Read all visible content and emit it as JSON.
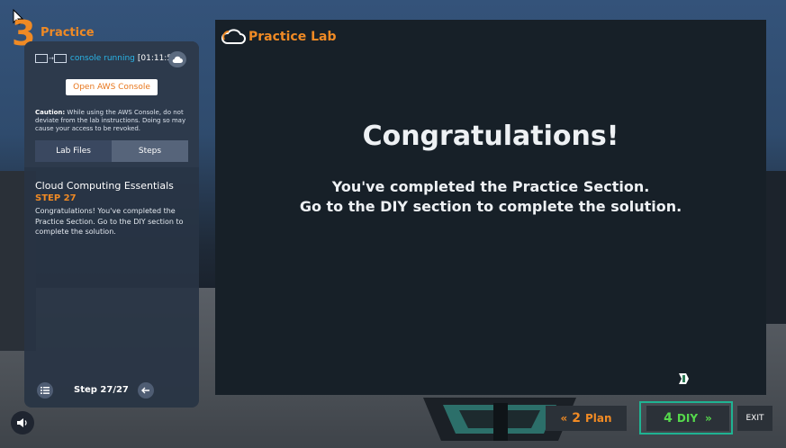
{
  "phase": {
    "number": "3",
    "title": "Practice"
  },
  "left_panel": {
    "console_state": "console running",
    "timer": "[01:11:55]",
    "open_console_label": "Open AWS Console",
    "caution_label": "Caution:",
    "caution_text": " While using the AWS Console, do not deviate from the lab instructions. Doing so may cause your access to be revoked.",
    "tabs": [
      {
        "label": "Lab Files"
      },
      {
        "label": "Steps"
      }
    ],
    "course_title": "Cloud Computing Essentials",
    "step_label": "STEP 27",
    "step_text": "Congratulations! You've completed the Practice Section. Go to the DIY section to complete the solution.",
    "step_counter": "Step 27/27"
  },
  "main": {
    "logo_title": "Practice Lab",
    "heading": "Congratulations!",
    "line1": "You've completed the Practice Section.",
    "line2": "Go to the DIY section to complete the solution."
  },
  "nav": {
    "plan": {
      "number": "2",
      "label": "Plan"
    },
    "diy": {
      "number": "4",
      "label": "DIY"
    },
    "exit": "EXIT"
  },
  "colors": {
    "accent_orange": "#f08a24",
    "accent_green": "#55d84c",
    "frame_teal": "#1fb392",
    "status_blue": "#2ab4e6"
  },
  "icons": [
    "cursor-icon",
    "cloud-icon",
    "list-icon",
    "back-arrow-icon",
    "speaker-icon",
    "chevron-left-double-icon",
    "chevron-right-double-icon",
    "monitor-icon",
    "marker-icon"
  ]
}
